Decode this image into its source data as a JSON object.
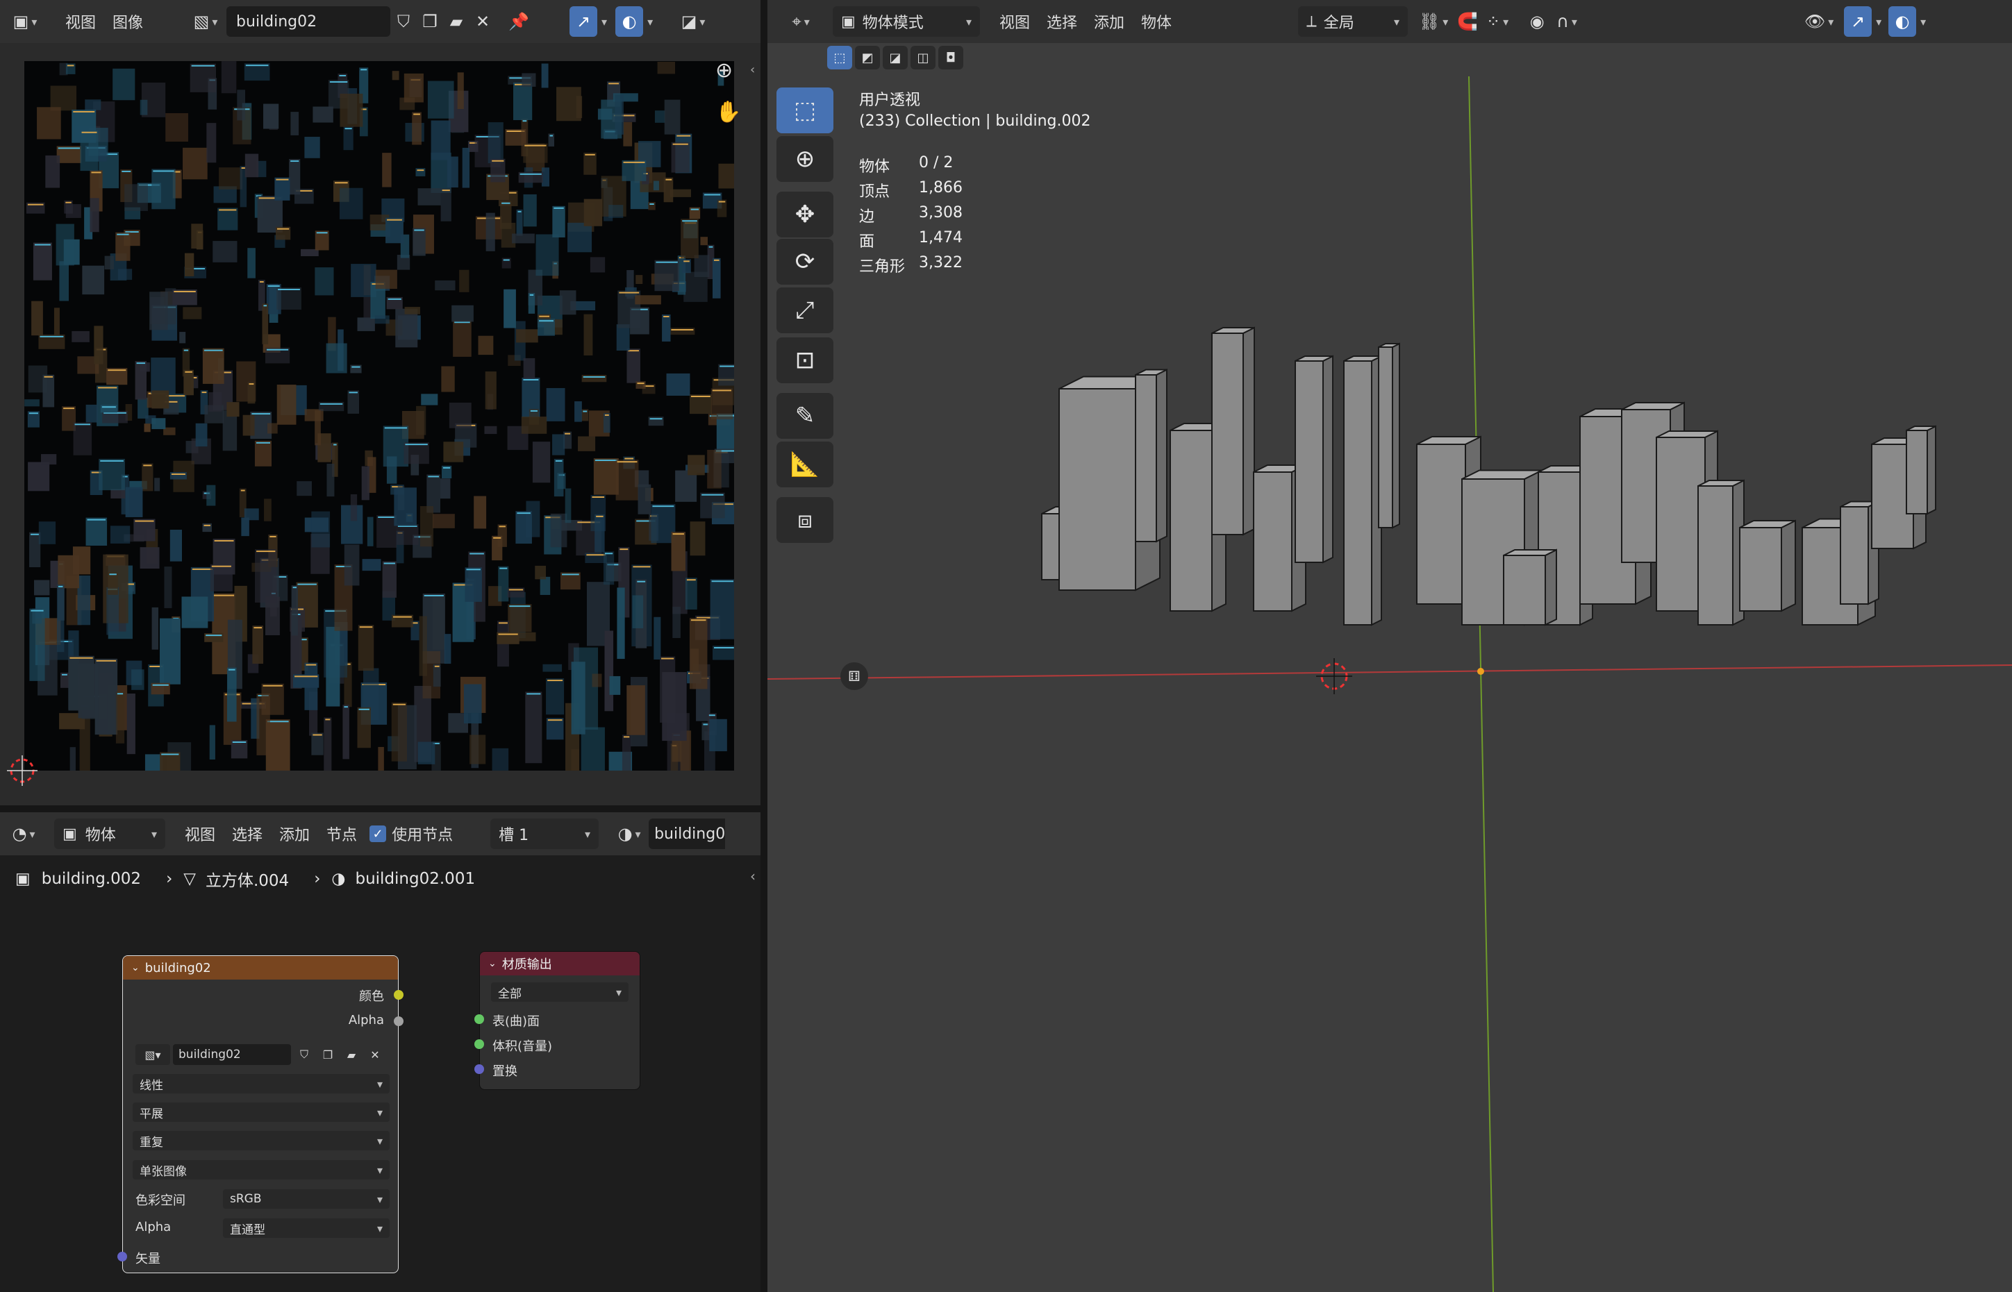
{
  "image_editor": {
    "menu": [
      "视图",
      "图像"
    ],
    "image_name": "building02",
    "colors": {
      "canvas_bg": "#2b2b2b",
      "texture_bg": "#050607"
    }
  },
  "node_editor": {
    "object_mode": "物体",
    "menu": [
      "视图",
      "选择",
      "添加",
      "节点"
    ],
    "use_nodes_label": "使用节点",
    "use_nodes_checked": true,
    "slot": "槽 1",
    "material_field": "building0",
    "breadcrumb": [
      "building.002",
      "立方体.004",
      "building02.001"
    ],
    "image_node": {
      "title": "building02",
      "out_color": "颜色",
      "out_alpha": "Alpha",
      "image_name": "building02",
      "interpolation": "线性",
      "projection": "平展",
      "extension": "重复",
      "source": "单张图像",
      "colorspace_label": "色彩空间",
      "colorspace": "sRGB",
      "alpha_label": "Alpha",
      "alpha_mode": "直通型",
      "vector_label": "矢量"
    },
    "output_node": {
      "title": "材质输出",
      "target": "全部",
      "surface": "表(曲)面",
      "volume": "体积(音量)",
      "displacement": "置换"
    }
  },
  "viewport": {
    "mode": "物体模式",
    "menu": [
      "视图",
      "选择",
      "添加",
      "物体"
    ],
    "orientation": "全局",
    "view_name": "用户透视",
    "collection_info": "(233) Collection | building.002",
    "stats": [
      {
        "label": "物体",
        "value": "0 / 2"
      },
      {
        "label": "顶点",
        "value": "1,866"
      },
      {
        "label": "边",
        "value": "3,308"
      },
      {
        "label": "面",
        "value": "1,474"
      },
      {
        "label": "三角形",
        "value": "3,322"
      }
    ],
    "colors": {
      "bg": "#3d3d3d",
      "x_axis": "#b33a3a",
      "y_axis": "#6f9b2a",
      "accent": "#4772b3"
    }
  }
}
